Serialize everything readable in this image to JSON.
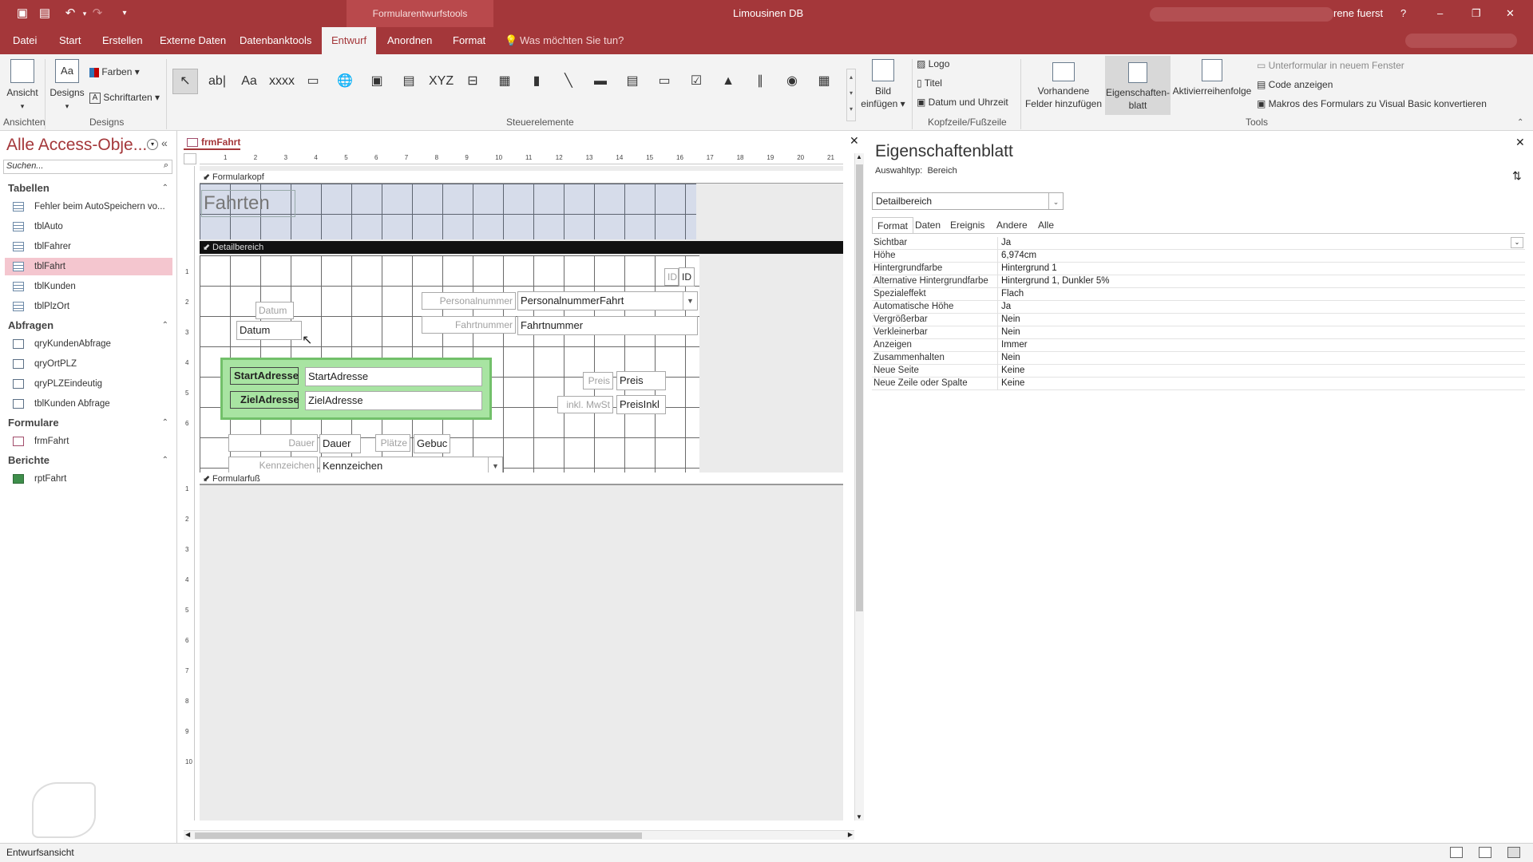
{
  "colors": {
    "accent": "#a4373a",
    "highlight_nav": "#f4c6cf",
    "group_green": "#a8e4a2"
  },
  "titlebar": {
    "app_title": "Limousinen DB",
    "context_tab": "Formularentwurfstools",
    "user": "rene fuerst",
    "help": "?",
    "min": "–",
    "restore": "❐",
    "close": "✕"
  },
  "tabs": [
    "Datei",
    "Start",
    "Erstellen",
    "Externe Daten",
    "Datenbanktools",
    "Entwurf",
    "Anordnen",
    "Format"
  ],
  "tellme": "Was möchten Sie tun?",
  "ribbon": {
    "view_label": "Ansicht",
    "designs_label": "Designs",
    "farben": "Farben",
    "schriftarten": "Schriftarten",
    "group_ansichten": "Ansichten",
    "group_designs": "Designs",
    "group_steuerelemente": "Steuerelemente",
    "group_kopfzeile": "Kopfzeile/Fußzeile",
    "group_tools": "Tools",
    "bild_einfuegen": [
      "Bild",
      "einfügen"
    ],
    "logo": "Logo",
    "titel": "Titel",
    "datum_uhrzeit": "Datum und Uhrzeit",
    "vorhandene": [
      "Vorhandene",
      "Felder hinzufügen"
    ],
    "eigenschaften": [
      "Eigenschaften-",
      "blatt"
    ],
    "aktivierreihenfolge": "Aktivierreihenfolge",
    "unterformular": "Unterformular in neuem Fenster",
    "code": "Code anzeigen",
    "makros": "Makros des Formulars zu Visual Basic konvertieren",
    "controls": [
      "pointer",
      "textbox",
      "label",
      "button",
      "tab",
      "hyperlink",
      "webbrowser",
      "navigation",
      "option-group",
      "page-break",
      "combo",
      "chart",
      "line",
      "toggle",
      "listbox",
      "rectangle",
      "checkbox",
      "image",
      "attachment",
      "option",
      "subform"
    ],
    "control_glyphs": [
      "↖",
      "ab|",
      "Aa",
      "xxxx",
      "▭",
      "🌐",
      "▣",
      "▤",
      "XYZ",
      "⊟",
      "▦",
      "▮",
      "╲",
      "▬",
      "▤",
      "▭",
      "☑",
      "▲",
      "∥",
      "◉",
      "▦"
    ]
  },
  "nav": {
    "title": "Alle Access-Obje...",
    "search_placeholder": "Suchen...",
    "sections": [
      {
        "name": "Tabellen",
        "items": [
          {
            "label": "Fehler beim AutoSpeichern vo...",
            "type": "t"
          },
          {
            "label": "tblAuto",
            "type": "t"
          },
          {
            "label": "tblFahrer",
            "type": "t"
          },
          {
            "label": "tblFahrt",
            "type": "t",
            "selected": true
          },
          {
            "label": "tblKunden",
            "type": "t"
          },
          {
            "label": "tblPlzOrt",
            "type": "t"
          }
        ]
      },
      {
        "name": "Abfragen",
        "items": [
          {
            "label": "qryKundenAbfrage",
            "type": "q"
          },
          {
            "label": "qryOrtPLZ",
            "type": "q"
          },
          {
            "label": "qryPLZEindeutig",
            "type": "q"
          },
          {
            "label": "tblKunden Abfrage",
            "type": "q"
          }
        ]
      },
      {
        "name": "Formulare",
        "items": [
          {
            "label": "frmFahrt",
            "type": "f"
          }
        ]
      },
      {
        "name": "Berichte",
        "items": [
          {
            "label": "rptFahrt",
            "type": "r"
          }
        ]
      }
    ]
  },
  "form": {
    "tab_title": "frmFahrt",
    "formularkopf": "Formularkopf",
    "detailbereich": "Detailbereich",
    "formularfuss": "Formularfuß",
    "header_title": "Fahrten",
    "ruler_h": [
      "1",
      "2",
      "3",
      "4",
      "5",
      "6",
      "7",
      "8",
      "9",
      "10",
      "11",
      "12",
      "13",
      "14",
      "15",
      "16",
      "17",
      "18",
      "19",
      "20",
      "21"
    ],
    "ruler_v": [
      "1",
      "2",
      "3",
      "4",
      "5",
      "6",
      "1",
      "2",
      "3",
      "4",
      "5",
      "6",
      "7",
      "8",
      "9",
      "10"
    ],
    "controls": {
      "id_lbl": "ID",
      "id_txt": "ID",
      "datum_lbl": "Datum",
      "datum_txt": "Datum",
      "pers_lbl": "Personalnummer",
      "pers_txt": "PersonalnummerFahrt",
      "fahrt_lbl": "Fahrtnummer",
      "fahrt_txt": "Fahrtnummer",
      "start_lbl": "StartAdresse",
      "start_txt": "StartAdresse",
      "ziel_lbl": "ZielAdresse",
      "ziel_txt": "ZielAdresse",
      "preis_lbl": "Preis",
      "preis_txt": "Preis",
      "mwst_lbl": "inkl. MwSt",
      "mwst_txt": "PreisInkl",
      "dauer_lbl": "Dauer",
      "dauer_txt": "Dauer",
      "plaetze_lbl": "Plätze",
      "gebucht_txt": "Gebuc",
      "kenn_lbl": "Kennzeichen",
      "kenn_txt": "Kennzeichen"
    }
  },
  "props": {
    "title": "Eigenschaftenblatt",
    "auswahltyp_label": "Auswahltyp:",
    "auswahltyp_value": "Bereich",
    "selector": "Detailbereich",
    "tabs": [
      "Format",
      "Daten",
      "Ereignis",
      "Andere",
      "Alle"
    ],
    "rows": [
      [
        "Sichtbar",
        "Ja"
      ],
      [
        "Höhe",
        "6,974cm"
      ],
      [
        "Hintergrundfarbe",
        "Hintergrund 1"
      ],
      [
        "Alternative Hintergrundfarbe",
        "Hintergrund 1, Dunkler 5%"
      ],
      [
        "Spezialeffekt",
        "Flach"
      ],
      [
        "Automatische Höhe",
        "Ja"
      ],
      [
        "Vergrößerbar",
        "Nein"
      ],
      [
        "Verkleinerbar",
        "Nein"
      ],
      [
        "Anzeigen",
        "Immer"
      ],
      [
        "Zusammenhalten",
        "Nein"
      ],
      [
        "Neue Seite",
        "Keine"
      ],
      [
        "Neue Zeile oder Spalte",
        "Keine"
      ]
    ]
  },
  "status": {
    "mode": "Entwurfsansicht"
  }
}
